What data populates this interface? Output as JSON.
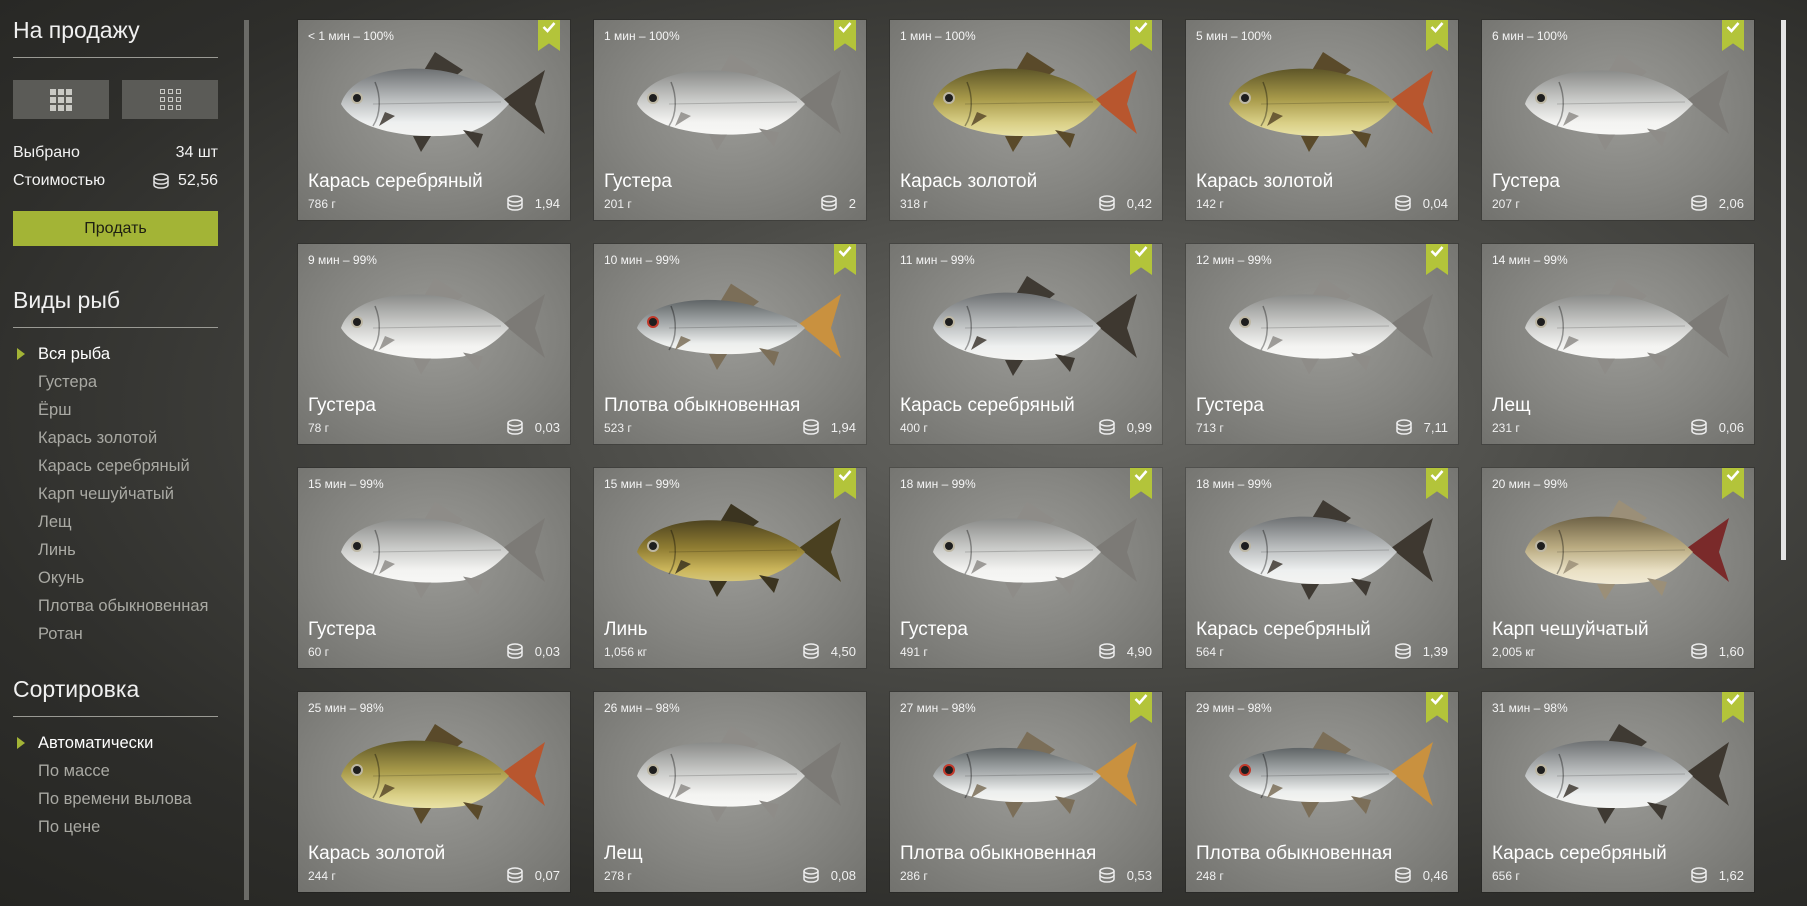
{
  "sidebar": {
    "for_sale_title": "На продажу",
    "view_buttons": [
      {
        "icon": "large-grid-icon"
      },
      {
        "icon": "small-grid-icon"
      }
    ],
    "selected_label": "Выбрано",
    "selected_value": "34 шт",
    "cost_label": "Стоимостью",
    "cost_value": "52,56",
    "sell_button": "Продать",
    "species_title": "Виды рыб",
    "species": [
      {
        "label": "Вся рыба",
        "active": true
      },
      {
        "label": "Густера",
        "active": false
      },
      {
        "label": "Ёрш",
        "active": false
      },
      {
        "label": "Карась золотой",
        "active": false
      },
      {
        "label": "Карась серебряный",
        "active": false
      },
      {
        "label": "Карп чешуйчатый",
        "active": false
      },
      {
        "label": "Лещ",
        "active": false
      },
      {
        "label": "Линь",
        "active": false
      },
      {
        "label": "Окунь",
        "active": false
      },
      {
        "label": "Плотва обыкновенная",
        "active": false
      },
      {
        "label": "Ротан",
        "active": false
      }
    ],
    "sort_title": "Сортировка",
    "sort": [
      {
        "label": "Автоматически",
        "active": true
      },
      {
        "label": "По массе",
        "active": false
      },
      {
        "label": "По времени вылова",
        "active": false
      },
      {
        "label": "По цене",
        "active": false
      }
    ]
  },
  "colors": {
    "accent": "#a3b436",
    "bookmark": "#b3c43a"
  },
  "fish": [
    {
      "time": "< 1 мин – 100%",
      "name": "Карась серебряный",
      "weight": "786 г",
      "price": "1,94",
      "selected": true,
      "kind": "silver_crucian"
    },
    {
      "time": "1 мин – 100%",
      "name": "Густера",
      "weight": "201 г",
      "price": "2",
      "selected": true,
      "kind": "bream_silver"
    },
    {
      "time": "1 мин – 100%",
      "name": "Карась золотой",
      "weight": "318 г",
      "price": "0,42",
      "selected": true,
      "kind": "golden_crucian"
    },
    {
      "time": "5 мин – 100%",
      "name": "Карась золотой",
      "weight": "142 г",
      "price": "0,04",
      "selected": true,
      "kind": "golden_crucian"
    },
    {
      "time": "6 мин – 100%",
      "name": "Густера",
      "weight": "207 г",
      "price": "2,06",
      "selected": true,
      "kind": "bream_silver"
    },
    {
      "time": "9 мин – 99%",
      "name": "Густера",
      "weight": "78 г",
      "price": "0,03",
      "selected": false,
      "kind": "bream_silver"
    },
    {
      "time": "10 мин – 99%",
      "name": "Плотва обыкновенная",
      "weight": "523 г",
      "price": "1,94",
      "selected": true,
      "kind": "roach"
    },
    {
      "time": "11 мин – 99%",
      "name": "Карась серебряный",
      "weight": "400 г",
      "price": "0,99",
      "selected": true,
      "kind": "silver_crucian"
    },
    {
      "time": "12 мин – 99%",
      "name": "Густера",
      "weight": "713 г",
      "price": "7,11",
      "selected": true,
      "kind": "bream_silver"
    },
    {
      "time": "14 мин – 99%",
      "name": "Лещ",
      "weight": "231 г",
      "price": "0,06",
      "selected": false,
      "kind": "bream_silver"
    },
    {
      "time": "15 мин – 99%",
      "name": "Густера",
      "weight": "60 г",
      "price": "0,03",
      "selected": false,
      "kind": "bream_silver"
    },
    {
      "time": "15 мин – 99%",
      "name": "Линь",
      "weight": "1,056 кг",
      "price": "4,50",
      "selected": true,
      "kind": "tench"
    },
    {
      "time": "18 мин – 99%",
      "name": "Густера",
      "weight": "491 г",
      "price": "4,90",
      "selected": true,
      "kind": "bream_silver"
    },
    {
      "time": "18 мин – 99%",
      "name": "Карась серебряный",
      "weight": "564 г",
      "price": "1,39",
      "selected": true,
      "kind": "silver_crucian"
    },
    {
      "time": "20 мин – 99%",
      "name": "Карп чешуйчатый",
      "weight": "2,005 кг",
      "price": "1,60",
      "selected": true,
      "kind": "carp"
    },
    {
      "time": "25 мин – 98%",
      "name": "Карась золотой",
      "weight": "244 г",
      "price": "0,07",
      "selected": false,
      "kind": "golden_crucian"
    },
    {
      "time": "26 мин – 98%",
      "name": "Лещ",
      "weight": "278 г",
      "price": "0,08",
      "selected": false,
      "kind": "bream_silver"
    },
    {
      "time": "27 мин – 98%",
      "name": "Плотва обыкновенная",
      "weight": "286 г",
      "price": "0,53",
      "selected": true,
      "kind": "roach"
    },
    {
      "time": "29 мин – 98%",
      "name": "Плотва обыкновенная",
      "weight": "248 г",
      "price": "0,46",
      "selected": true,
      "kind": "roach"
    },
    {
      "time": "31 мин – 98%",
      "name": "Карась серебряный",
      "weight": "656 г",
      "price": "1,62",
      "selected": true,
      "kind": "silver_crucian"
    }
  ]
}
